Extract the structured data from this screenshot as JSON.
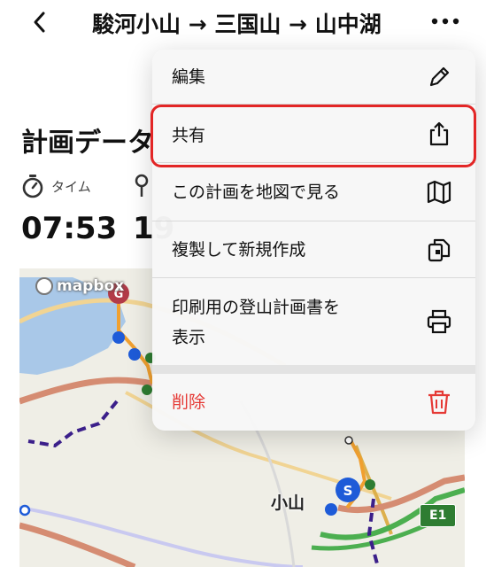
{
  "header": {
    "title": "駿河小山 → 三国山 → 山中湖",
    "back_icon": "chevron-left-icon",
    "more_icon": "ellipsis-icon"
  },
  "section": {
    "title": "計画データ",
    "time_label": "タイム",
    "time_value": "07:53",
    "second_value": "19"
  },
  "map": {
    "attribution": "mapbox",
    "place_label": "小山",
    "road_shield": "E1"
  },
  "menu": {
    "items": [
      {
        "label": "編集",
        "icon": "pencil-icon"
      },
      {
        "label": "共有",
        "icon": "share-icon"
      },
      {
        "label": "この計画を地図で見る",
        "icon": "map-icon"
      },
      {
        "label": "複製して新規作成",
        "icon": "copy-icon"
      },
      {
        "label": "印刷用の登山計画書を",
        "label2": "表示",
        "icon": "printer-icon"
      },
      {
        "label": "削除",
        "icon": "trash-icon"
      }
    ],
    "delete_color": "#e53935",
    "highlight_color": "#e32626"
  }
}
